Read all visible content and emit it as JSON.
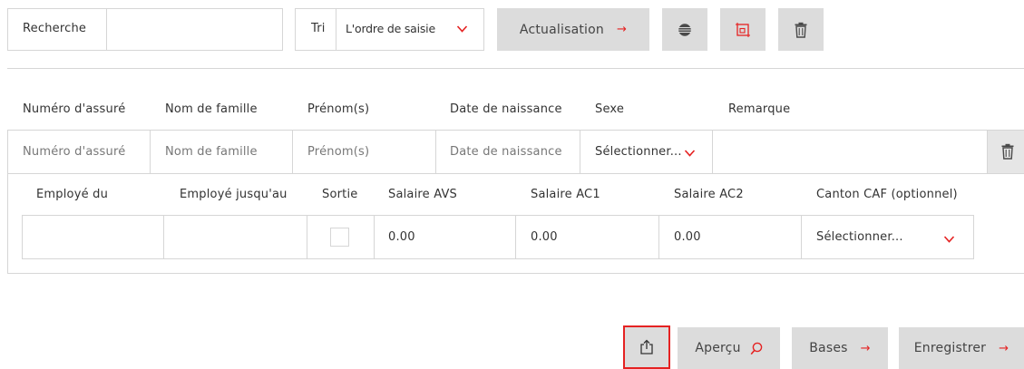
{
  "toolbar": {
    "search_label": "Recherche",
    "search_value": "",
    "sort_label": "Tri",
    "sort_value": "L'ordre de saisie",
    "refresh_label": "Actualisation",
    "refresh_arrow": "→"
  },
  "person": {
    "headers": [
      "Numéro d'assuré",
      "Nom de famille",
      "Prénom(s)",
      "Date de naissance",
      "Sexe",
      "Remarque"
    ],
    "placeholders": {
      "insured_number": "Numéro d'assuré",
      "last_name": "Nom de famille",
      "first_name": "Prénom(s)",
      "birth_date": "Date de naissance",
      "sex": "Sélectionner...",
      "remark": ""
    }
  },
  "employment": {
    "headers": [
      "Employé du",
      "Employé jusqu'au",
      "Sortie",
      "Salaire AVS",
      "Salaire AC1",
      "Salaire AC2",
      "Canton CAF (optionnel)"
    ],
    "row": {
      "from": "",
      "to": "",
      "exit_checked": false,
      "avs": "0.00",
      "ac1": "0.00",
      "ac2": "0.00",
      "canton": "Sélectionner..."
    }
  },
  "footer": {
    "preview_label": "Aperçu",
    "bases_label": "Bases",
    "bases_arrow": "→",
    "save_label": "Enregistrer",
    "save_arrow": "→"
  },
  "colors": {
    "accent": "#e52222",
    "button_bg": "#dcdcdc",
    "border": "#d6d6d6"
  },
  "icons": [
    "globe-icon",
    "frame-icon",
    "trash-icon",
    "share-icon",
    "search-icon",
    "chevron-down-icon"
  ]
}
